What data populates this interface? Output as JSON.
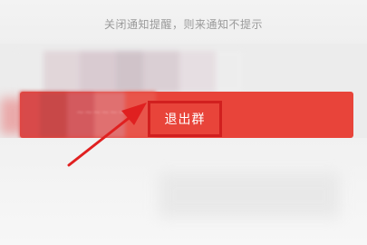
{
  "notice": {
    "text": "关闭通知提醒，则来通知不提示"
  },
  "exit_group": {
    "label": "退出群",
    "background_color": "#e8443a",
    "highlight_border_color": "#d11f1f"
  },
  "annotation": {
    "arrow_icon": "red-arrow-icon",
    "color": "#e02020"
  }
}
